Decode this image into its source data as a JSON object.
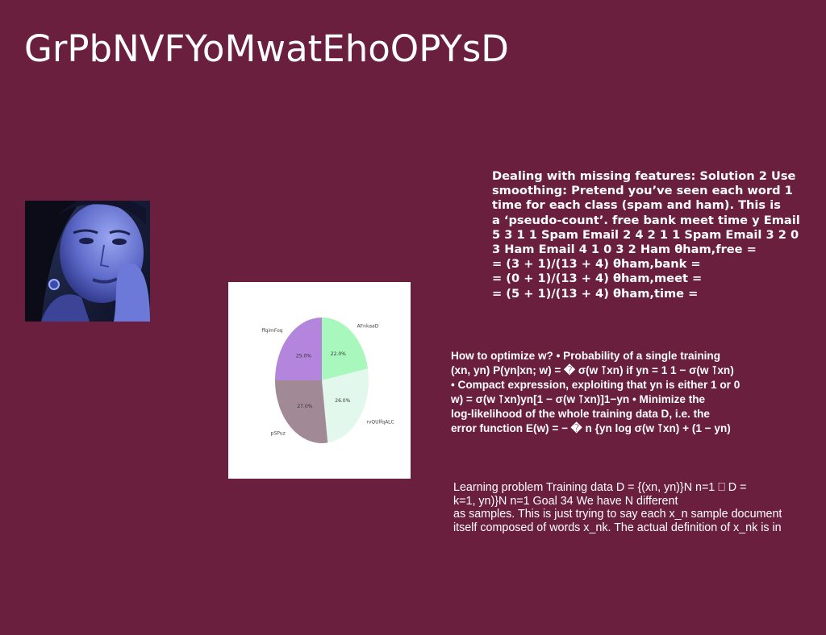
{
  "title": "GrPbNVFYoMwatEhoOPYsD",
  "image": {
    "description_icon": "portrait-photo"
  },
  "chart_data": {
    "type": "pie",
    "labels": [
      "AFnkaaD",
      "rvQUlfqALC",
      "pSPuz",
      "ffqimFoq"
    ],
    "values": [
      22.0,
      26.0,
      27.0,
      25.0
    ],
    "value_labels": [
      "22.0%",
      "26.0%",
      "27.0%",
      "25.0%"
    ],
    "colors": [
      "#a8f7bd",
      "#e2f8ec",
      "#a18a96",
      "#b385dc"
    ]
  },
  "text_block_1": [
    "Dealing with missing features: Solution 2 Use",
    "smoothing: Pretend you’ve seen each word 1",
    "time for each class (spam and ham). This is",
    "a ‘pseudo-count’. free bank meet time y Email",
    "5 3 1 1 Spam Email 2 4 2 1 1 Spam Email 3 2 0",
    "3 Ham Email 4 1 0 3 2 Ham θham,free =",
    "= (3 + 1)/(13 + 4) θham,bank =",
    "= (0 + 1)/(13 + 4) θham,meet =",
    "= (5 + 1)/(13 + 4) θham,time ="
  ],
  "text_block_2": [
    "How to optimize w? • Probability of a single training",
    "(xn, yn) P(yn|xn; w) = � σ(w ⊺xn) if yn = 1 1 − σ(w ⊺xn)",
    "• Compact expression, exploiting that yn is either 1 or 0",
    "w) = σ(w ⊺xn)yn[1 − σ(w ⊺xn)]1−yn • Minimize the",
    "log-likelihood of the whole training data D, i.e. the",
    "error function E(w) = − � n {yn log σ(w ⊺xn) + (1 − yn)"
  ],
  "text_block_3": [
    "Learning problem Training data D = {(xn, yn)}N n=1 ⎕ D =",
    "k=1, yn)}N n=1 Goal 34 We have N different",
    "as samples. This is just trying to say each x_n sample document",
    "itself composed of words x_nk. The actual definition of x_nk is in"
  ]
}
